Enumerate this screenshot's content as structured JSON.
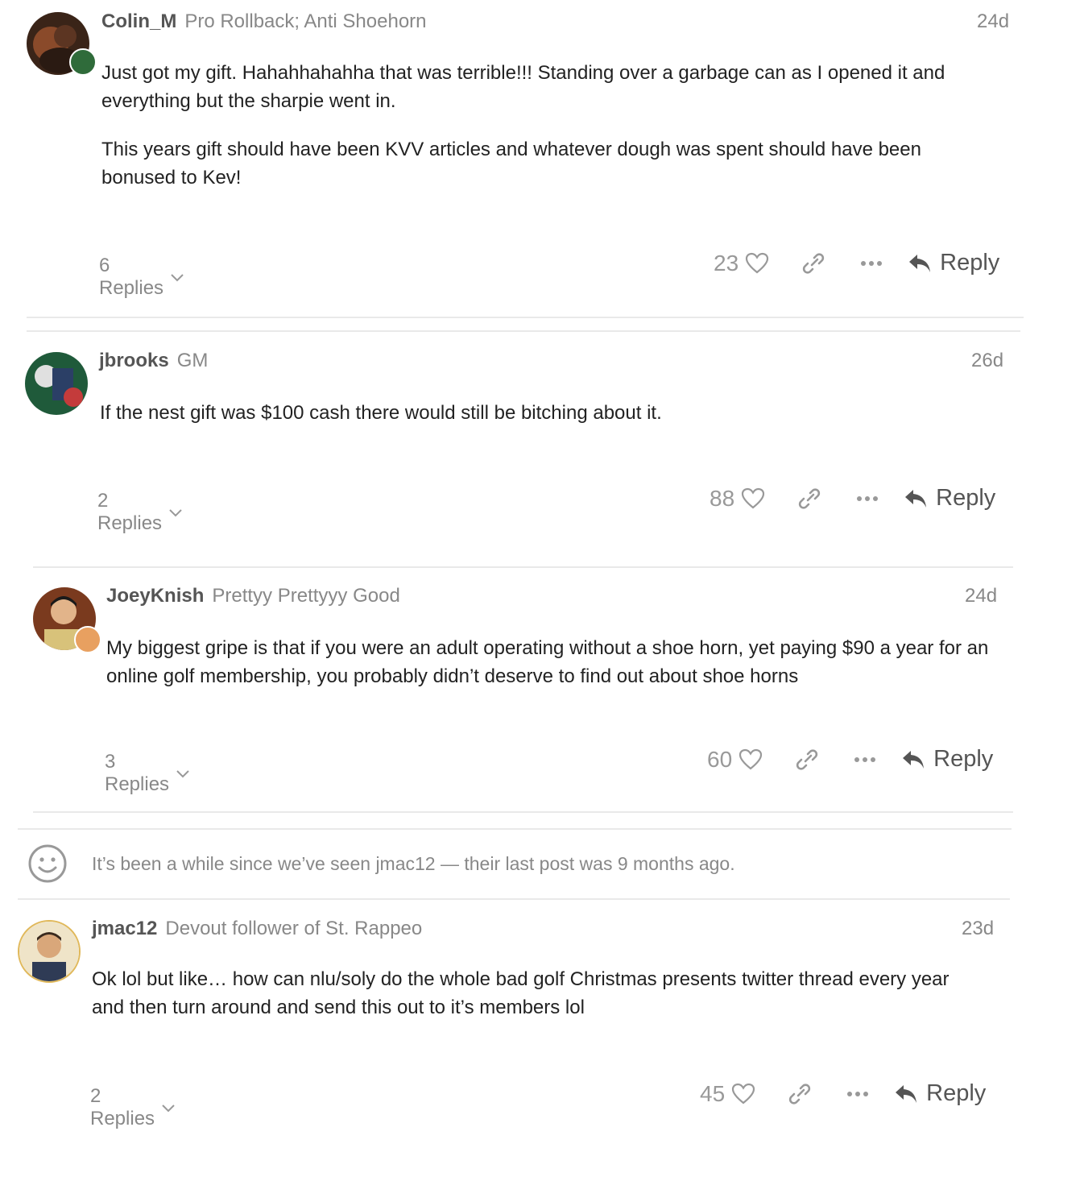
{
  "posts": [
    {
      "username": "Colin_M",
      "user_title": "Pro Rollback; Anti Shoehorn",
      "date": "24d",
      "paragraphs": [
        "Just got my gift. Hahahhahahha that was terrible!!! Standing over a garbage can as I opened it and everything but the sharpie went in.",
        "This years gift should have been KVV articles and whatever dough was spent should have been bonused to Kev!"
      ],
      "replies_label": "6 Replies",
      "likes": "23",
      "reply_label": "Reply"
    },
    {
      "username": "jbrooks",
      "user_title": "GM",
      "date": "26d",
      "paragraphs": [
        "If the nest gift was $100 cash there would still be bitching about it."
      ],
      "replies_label": "2 Replies",
      "likes": "88",
      "reply_label": "Reply"
    },
    {
      "username": "JoeyKnish",
      "user_title": "Prettyy Prettyyy Good",
      "date": "24d",
      "paragraphs": [
        "My biggest gripe is that if you were an adult operating without a shoe horn, yet paying $90 a year for an online golf membership, you probably didn’t deserve to find out about shoe horns"
      ],
      "replies_label": "3 Replies",
      "likes": "60",
      "reply_label": "Reply"
    },
    {
      "username": "jmac12",
      "user_title": "Devout follower of St. Rappeo",
      "date": "23d",
      "paragraphs": [
        "Ok lol but like… how can nlu/soly do the whole bad golf Christmas presents twitter thread every year and then turn around and send this out to it’s members lol"
      ],
      "replies_label": "2 Replies",
      "likes": "45",
      "reply_label": "Reply"
    }
  ],
  "notice": {
    "text": "It’s been a while since we’ve seen jmac12 — their last post was 9 months ago.",
    "icon": "smiley-icon"
  },
  "icons": {
    "like": "heart-icon",
    "link": "link-icon",
    "more": "ellipsis-icon",
    "reply": "reply-arrow-icon",
    "expand": "chevron-down-icon"
  },
  "colors": {
    "text": "#222222",
    "muted": "#888888",
    "divider": "#e9e9e9"
  }
}
